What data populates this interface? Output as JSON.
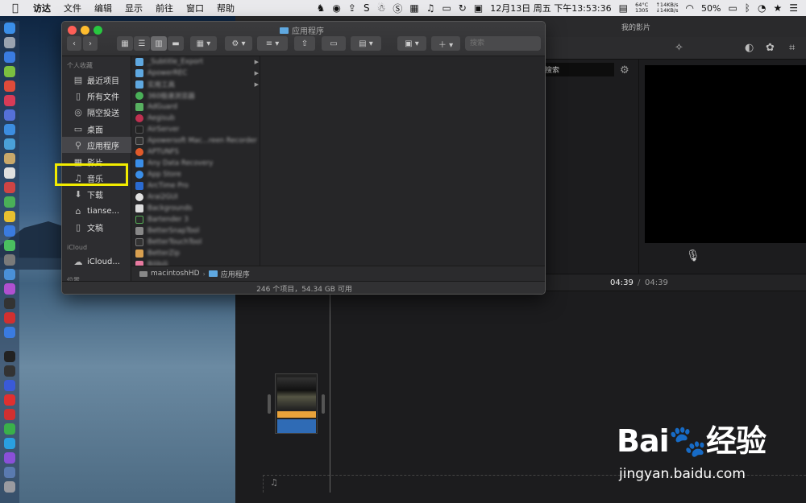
{
  "menubar": {
    "app_name": "访达",
    "items": [
      "文件",
      "编辑",
      "显示",
      "前往",
      "窗口",
      "帮助"
    ],
    "temp_line1": "64°C",
    "temp_line2": "1305",
    "net_up": "↑14KB/s",
    "net_down": "↓14KB/s",
    "clock": "12月13日 周五 下午13:53:36",
    "battery": "50%"
  },
  "imovie": {
    "window_title": "我的影片",
    "search_label": "搜索",
    "time_current": "04:39",
    "time_separator": "/",
    "time_total": "04:39"
  },
  "finder": {
    "window_title": "应用程序",
    "search_placeholder": "搜索",
    "sidebar": {
      "favorites_header": "个人收藏",
      "favorites": [
        {
          "icon": "clock-icon",
          "label": "最近项目"
        },
        {
          "icon": "document-icon",
          "label": "所有文件"
        },
        {
          "icon": "airdrop-icon",
          "label": "隔空投送"
        },
        {
          "icon": "desktop-icon",
          "label": "桌面"
        },
        {
          "icon": "applications-icon",
          "label": "应用程序"
        },
        {
          "icon": "film-icon",
          "label": "影片"
        },
        {
          "icon": "music-icon",
          "label": "音乐"
        },
        {
          "icon": "download-icon",
          "label": "下载"
        },
        {
          "icon": "home-icon",
          "label": "tianse..."
        },
        {
          "icon": "document-icon",
          "label": "文稿"
        }
      ],
      "icloud_header": "iCloud",
      "icloud": [
        {
          "icon": "cloud-icon",
          "label": "iCloud..."
        }
      ],
      "locations_header": "位置"
    },
    "files": [
      "_Subtitle_Export",
      "ApowerREC",
      "实用工具",
      "360极速浏览器",
      "AdGuard",
      "Aegisub",
      "AirServer",
      "Apowersoft Mac...reen Recorder",
      "APTUNFS",
      "Any Data Recovery",
      "App Store",
      "ArcTime Pro",
      "Arai2GUI",
      "Backgrounds",
      "Bartender 3",
      "BetterSnapTool",
      "BetterTouchTool",
      "BetterZip",
      "Bilibili"
    ],
    "path": [
      "macintoshHD",
      "应用程序"
    ],
    "status": "246 个项目，54.34 GB 可用"
  },
  "watermark": {
    "brand": "Bai🐾经验",
    "url": "jingyan.baidu.com"
  }
}
